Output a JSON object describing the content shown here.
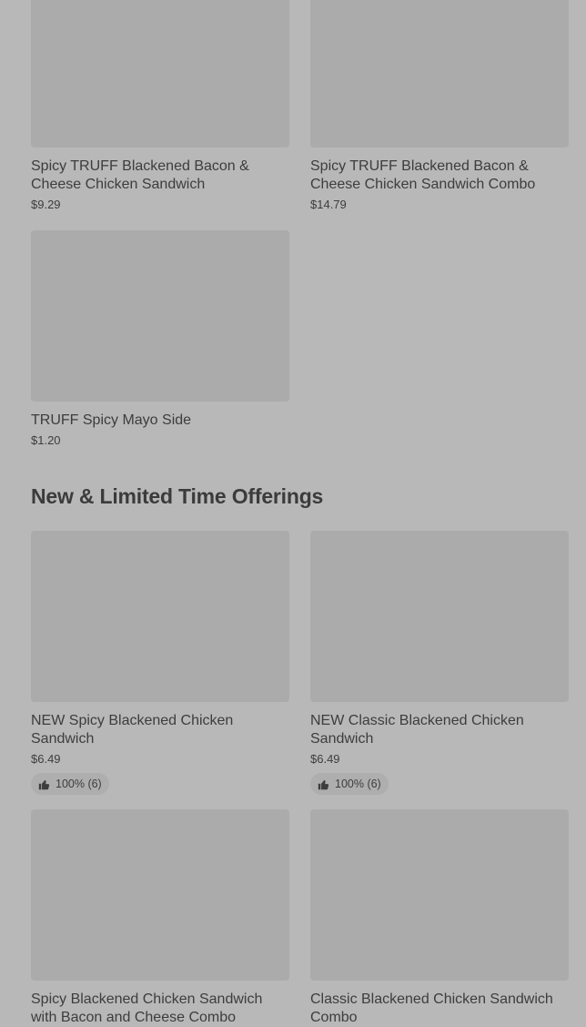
{
  "sections": [
    {
      "title": "",
      "items": [
        {
          "name": "Spicy TRUFF Blackened Bacon & Cheese Chicken Sandwich",
          "price": "$9.29"
        },
        {
          "name": "Spicy TRUFF Blackened Bacon & Cheese Chicken Sandwich Combo",
          "price": "$14.79"
        },
        {
          "name": "TRUFF Spicy Mayo Side",
          "price": "$1.20"
        }
      ]
    },
    {
      "title": "New & Limited Time Offerings",
      "items": [
        {
          "name": "NEW Spicy Blackened Chicken Sandwich",
          "price": "$6.49",
          "rating": "100% (6)"
        },
        {
          "name": "NEW Classic Blackened Chicken Sandwich",
          "price": "$6.49",
          "rating": "100% (6)"
        },
        {
          "name": "Spicy Blackened Chicken Sandwich with Bacon and Cheese Combo",
          "price": ""
        },
        {
          "name": "Classic Blackened Chicken Sandwich Combo",
          "price": ""
        }
      ]
    }
  ],
  "icons": {
    "rating": "thumbs-up-icon"
  },
  "colors": {
    "background": "#b8b8b8",
    "thumb": "#ababab",
    "text": "#3d3d3d"
  }
}
